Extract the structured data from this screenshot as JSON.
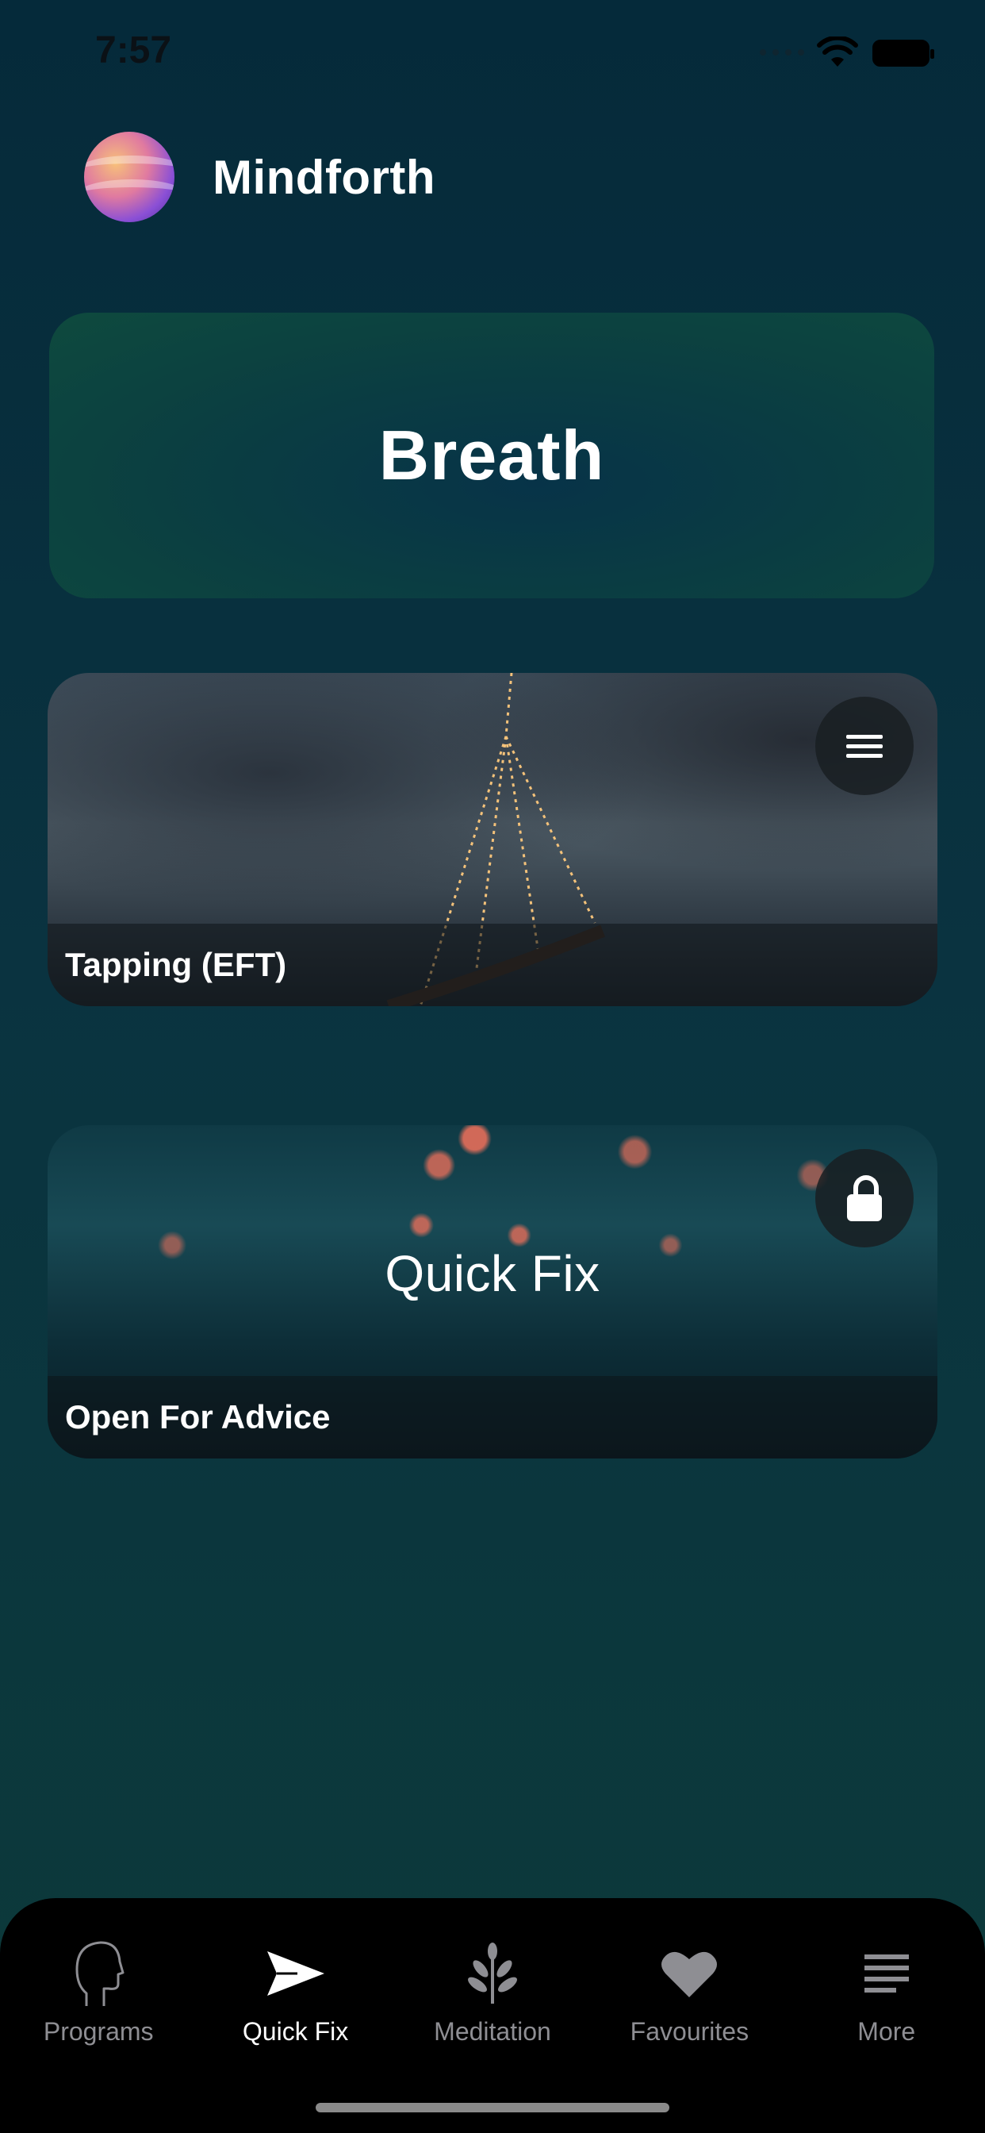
{
  "status_bar": {
    "time": "7:57"
  },
  "header": {
    "app_name": "Mindforth"
  },
  "breath_card": {
    "title": "Breath"
  },
  "cards": [
    {
      "footer_label": "Tapping (EFT)",
      "action_icon": "menu-icon"
    },
    {
      "overlay_title": "Quick Fix",
      "footer_label": "Open For Advice",
      "action_icon": "lock-icon"
    }
  ],
  "tab_bar": {
    "active_tab": "Quick Fix",
    "items": [
      {
        "label": "Programs",
        "icon": "head-profile-icon"
      },
      {
        "label": "Quick Fix",
        "icon": "paper-plane-icon"
      },
      {
        "label": "Meditation",
        "icon": "plant-icon"
      },
      {
        "label": "Favourites",
        "icon": "heart-icon"
      },
      {
        "label": "More",
        "icon": "list-icon"
      }
    ]
  },
  "colors": {
    "background_top": "#052a3a",
    "background_bottom": "#0c3a3a",
    "tab_bar": "#000000",
    "tab_active": "#ffffff",
    "tab_inactive": "#8e8e93"
  }
}
